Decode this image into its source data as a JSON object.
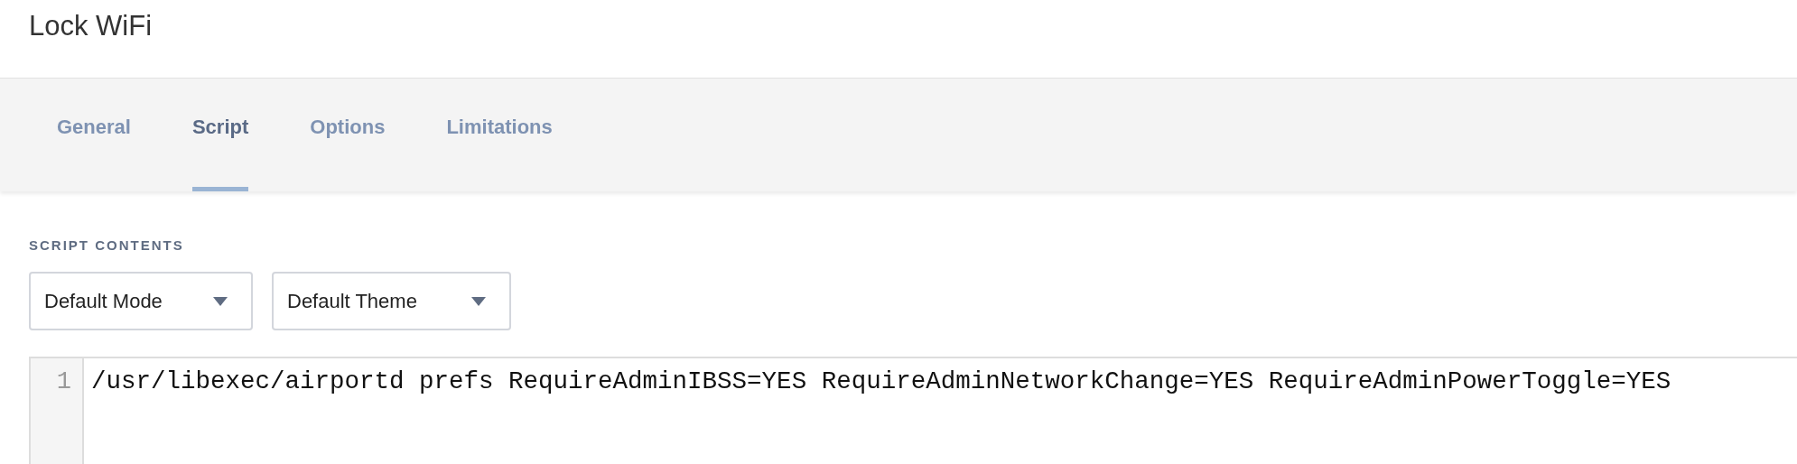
{
  "title": "Lock WiFi",
  "tabs": [
    {
      "label": "General",
      "selected": false
    },
    {
      "label": "Script",
      "selected": true
    },
    {
      "label": "Options",
      "selected": false
    },
    {
      "label": "Limitations",
      "selected": false
    }
  ],
  "section_label": "SCRIPT CONTENTS",
  "dropdowns": [
    {
      "value": "Default Mode"
    },
    {
      "value": "Default Theme"
    }
  ],
  "editor": {
    "lines": [
      {
        "number": "1",
        "code": "/usr/libexec/airportd prefs RequireAdminIBSS=YES RequireAdminNetworkChange=YES RequireAdminPowerToggle=YES"
      }
    ]
  }
}
